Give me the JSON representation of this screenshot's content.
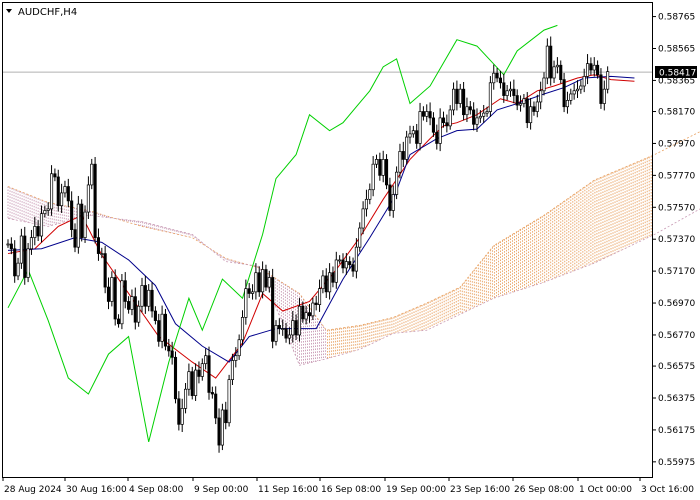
{
  "header": {
    "symbol_label": "AUDCHF,H4",
    "menu_icon": "triangle-down-icon"
  },
  "price_badge": {
    "value": "0.58417",
    "color": "#000000",
    "text_color": "#ffffff"
  },
  "colors": {
    "background": "#ffffff",
    "axis": "#000000",
    "candle": "#000000",
    "tenkan_sen": "#d00000",
    "kijun_sen": "#00008b",
    "chikou_span": "#00d000",
    "kumo_bearish": "#c89ab4",
    "kumo_bullish": "#e8a060",
    "price_line": "#b0b0b0"
  },
  "chart_data": {
    "type": "candlestick",
    "instrument": "AUDCHF",
    "timeframe": "H4",
    "indicator": "Ichimoku Kinko Hyo",
    "current_price": 0.58417,
    "ylim": [
      0.5588,
      0.5885
    ],
    "y_ticks": [
      "0.58765",
      "0.58565",
      "0.58365",
      "0.58170",
      "0.57970",
      "0.57770",
      "0.57570",
      "0.57370",
      "0.57170",
      "0.56970",
      "0.56770",
      "0.56575",
      "0.56375",
      "0.56175",
      "0.55975"
    ],
    "x_ticks": [
      "28 Aug 2024",
      "30 Aug 16:00",
      "4 Sep 08:00",
      "9 Sep 00:00",
      "11 Sep 16:00",
      "16 Sep 08:00",
      "19 Sep 00:00",
      "23 Sep 16:00",
      "26 Sep 08:00",
      "1 Oct 00:00",
      "3 Oct 16:00"
    ],
    "close": [
      0.5734,
      0.5731,
      0.5714,
      0.5722,
      0.5739,
      0.5713,
      0.5731,
      0.5738,
      0.5745,
      0.5739,
      0.5753,
      0.5755,
      0.5756,
      0.5778,
      0.5776,
      0.5758,
      0.5766,
      0.577,
      0.5761,
      0.5743,
      0.5732,
      0.5759,
      0.5738,
      0.5754,
      0.5771,
      0.5784,
      0.5738,
      0.5728,
      0.5728,
      0.5707,
      0.5698,
      0.5713,
      0.5687,
      0.5684,
      0.5711,
      0.5698,
      0.5693,
      0.5701,
      0.5685,
      0.5695,
      0.5708,
      0.5695,
      0.5705,
      0.5692,
      0.5686,
      0.5673,
      0.569,
      0.567,
      0.5667,
      0.5663,
      0.5637,
      0.5621,
      0.5631,
      0.5643,
      0.5654,
      0.5639,
      0.5655,
      0.5651,
      0.5659,
      0.5664,
      0.5641,
      0.564,
      0.5625,
      0.5608,
      0.563,
      0.5622,
      0.5649,
      0.5661,
      0.5664,
      0.5674,
      0.5688,
      0.5706,
      0.5703,
      0.5704,
      0.5716,
      0.5704,
      0.5718,
      0.5707,
      0.5713,
      0.5673,
      0.5683,
      0.5681,
      0.5681,
      0.5675,
      0.5677,
      0.5686,
      0.5677,
      0.5695,
      0.5687,
      0.5691,
      0.5689,
      0.5697,
      0.5696,
      0.5706,
      0.5714,
      0.5704,
      0.5716,
      0.571,
      0.5724,
      0.5724,
      0.5719,
      0.5723,
      0.5721,
      0.5717,
      0.5732,
      0.5744,
      0.5756,
      0.5762,
      0.5768,
      0.5784,
      0.5787,
      0.5777,
      0.5787,
      0.5771,
      0.5755,
      0.5765,
      0.5779,
      0.5792,
      0.5787,
      0.5801,
      0.5803,
      0.5805,
      0.5797,
      0.5817,
      0.5814,
      0.5817,
      0.5813,
      0.5804,
      0.5797,
      0.5813,
      0.581,
      0.5808,
      0.5818,
      0.5831,
      0.5822,
      0.5831,
      0.5815,
      0.582,
      0.5818,
      0.5809,
      0.5813,
      0.5814,
      0.5816,
      0.5817,
      0.5835,
      0.5841,
      0.5838,
      0.5835,
      0.5827,
      0.583,
      0.5831,
      0.5827,
      0.5821,
      0.5822,
      0.5825,
      0.581,
      0.582,
      0.5817,
      0.5823,
      0.583,
      0.5838,
      0.5858,
      0.5838,
      0.5845,
      0.5846,
      0.5837,
      0.582,
      0.5824,
      0.5828,
      0.583,
      0.5831,
      0.5833,
      0.5839,
      0.5847,
      0.5843,
      0.5846,
      0.584,
      0.5822,
      0.5831,
      0.5842
    ],
    "series": [
      {
        "name": "Tenkan-sen",
        "x": [
          0,
          8,
          15,
          22,
          28,
          35,
          45,
          55,
          62,
          70,
          76,
          82,
          90,
          98,
          105,
          112,
          120,
          126,
          130,
          134,
          140,
          147,
          152,
          158,
          163,
          170,
          175,
          180,
          187
        ],
        "values": [
          0.5728,
          0.5731,
          0.5745,
          0.5752,
          0.5727,
          0.5706,
          0.5676,
          0.566,
          0.565,
          0.5672,
          0.5703,
          0.5692,
          0.5698,
          0.5718,
          0.5738,
          0.5762,
          0.5787,
          0.58,
          0.5808,
          0.581,
          0.5815,
          0.5825,
          0.5822,
          0.583,
          0.5833,
          0.5838,
          0.584,
          0.5837,
          0.5836
        ]
      },
      {
        "name": "Kijun-sen",
        "x": [
          0,
          10,
          20,
          28,
          36,
          44,
          50,
          58,
          66,
          72,
          80,
          92,
          100,
          108,
          115,
          120,
          128,
          134,
          140,
          146,
          152,
          160,
          166,
          172,
          180,
          187
        ],
        "values": [
          0.573,
          0.5731,
          0.5738,
          0.5735,
          0.5724,
          0.5708,
          0.5684,
          0.567,
          0.566,
          0.5676,
          0.5681,
          0.5681,
          0.5712,
          0.5738,
          0.5762,
          0.579,
          0.58,
          0.5805,
          0.5806,
          0.5818,
          0.5822,
          0.5828,
          0.5832,
          0.5838,
          0.5839,
          0.5838
        ]
      },
      {
        "name": "Chikou Span",
        "x": [
          0,
          6,
          12,
          18,
          24,
          30,
          36,
          42,
          48,
          54,
          58,
          64,
          70,
          76,
          80,
          86,
          90,
          96,
          100,
          104,
          108,
          112,
          116,
          120,
          126,
          134,
          140,
          148,
          152,
          160,
          164
        ],
        "values": [
          0.5694,
          0.5718,
          0.5686,
          0.565,
          0.564,
          0.5665,
          0.5676,
          0.561,
          0.566,
          0.57,
          0.568,
          0.5712,
          0.57,
          0.574,
          0.5775,
          0.579,
          0.5815,
          0.5805,
          0.581,
          0.582,
          0.583,
          0.5845,
          0.585,
          0.5822,
          0.5833,
          0.5862,
          0.5858,
          0.584,
          0.5855,
          0.5868,
          0.5871
        ]
      },
      {
        "name": "Senkou Span A",
        "x": [
          0,
          12,
          24,
          40,
          55,
          65,
          75,
          87,
          95,
          105,
          115,
          125,
          135,
          145,
          160,
          175,
          193,
          210,
          226
        ],
        "values": [
          0.577,
          0.576,
          0.5755,
          0.5745,
          0.5738,
          0.5725,
          0.5719,
          0.5703,
          0.568,
          0.5683,
          0.5688,
          0.5697,
          0.5707,
          0.5733,
          0.5752,
          0.5774,
          0.579,
          0.5808,
          0.5818
        ]
      },
      {
        "name": "Senkou Span B",
        "x": [
          0,
          12,
          24,
          40,
          55,
          65,
          75,
          87,
          95,
          105,
          115,
          125,
          135,
          145,
          160,
          175,
          193,
          210,
          226
        ],
        "values": [
          0.575,
          0.5745,
          0.5752,
          0.5748,
          0.574,
          0.5723,
          0.572,
          0.5658,
          0.5662,
          0.5668,
          0.5678,
          0.568,
          0.569,
          0.57,
          0.571,
          0.5722,
          0.574,
          0.576,
          0.5785
        ]
      }
    ],
    "kumo_twist_index": 95
  }
}
